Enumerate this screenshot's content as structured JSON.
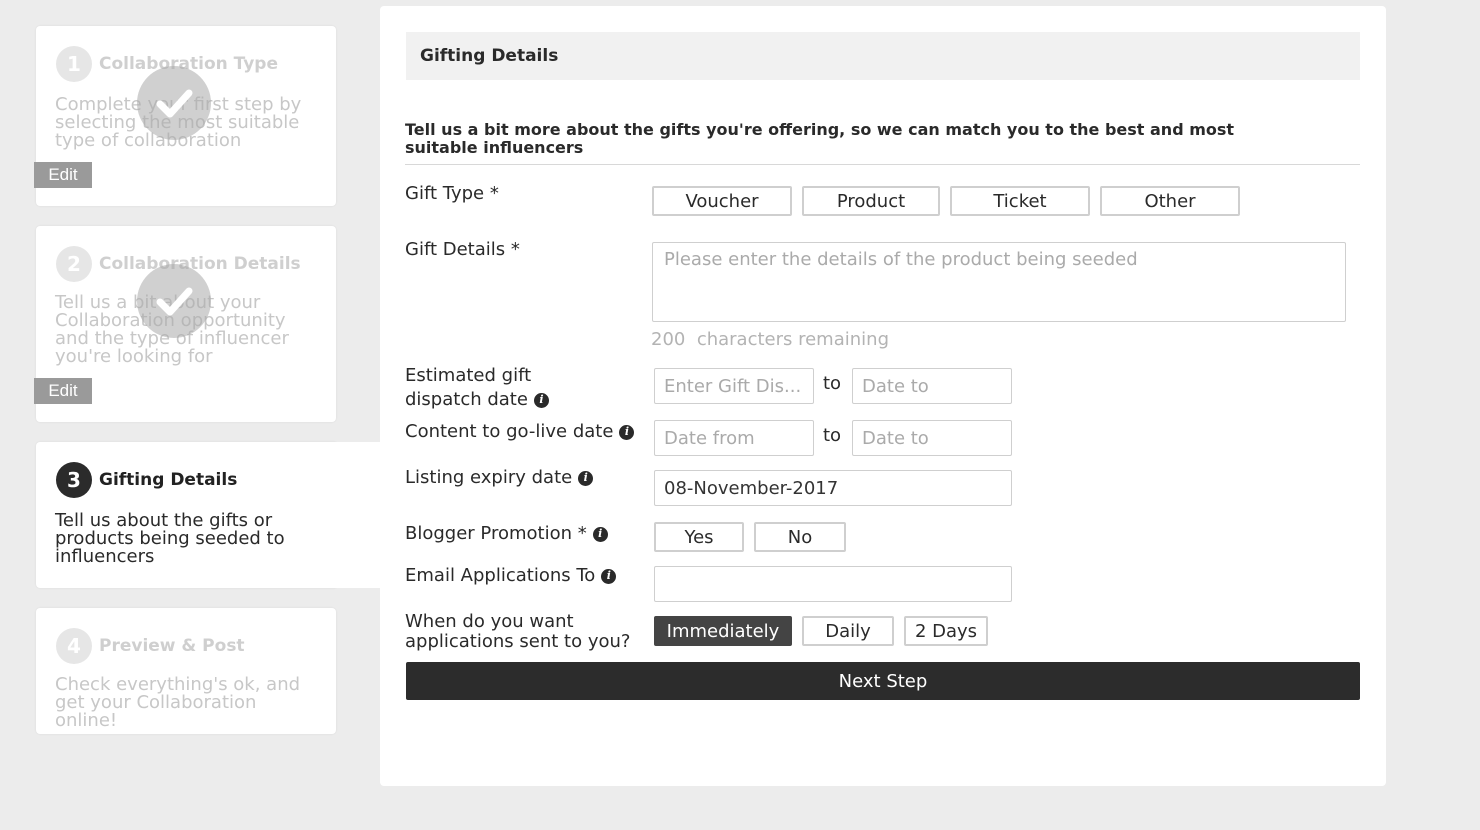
{
  "steps": [
    {
      "number": "1",
      "title": "Collaboration Type",
      "description": "Complete your first step by selecting the most suitable type of collaboration",
      "edit_label": "Edit",
      "status": "done"
    },
    {
      "number": "2",
      "title": "Collaboration Details",
      "description": "Tell us a bit about your Collaboration opportunity and the type of influencer you're looking for",
      "edit_label": "Edit",
      "status": "done"
    },
    {
      "number": "3",
      "title": "Gifting Details",
      "description": "Tell us about the gifts or products being seeded to influencers",
      "status": "active"
    },
    {
      "number": "4",
      "title": "Preview & Post",
      "description": "Check everything's ok, and get your Collaboration online!",
      "status": "pending"
    }
  ],
  "form": {
    "header": "Gifting Details",
    "intro": "Tell us a bit more about the gifts you're offering, so we can match you to the best and most suitable influencers",
    "gift_type": {
      "label": "Gift Type *",
      "options": [
        "Voucher",
        "Product",
        "Ticket",
        "Other"
      ]
    },
    "gift_details": {
      "label": "Gift Details *",
      "placeholder": "Please enter the details of the product being seeded",
      "chars_count": "200",
      "chars_text": "characters remaining"
    },
    "dispatch_date": {
      "label_line1": "Estimated gift",
      "label_line2": "dispatch date",
      "from_placeholder": "Enter Gift Dis...",
      "to_text": "to",
      "to_placeholder": "Date to"
    },
    "golive_date": {
      "label": "Content to go-live date",
      "from_placeholder": "Date from",
      "to_text": "to",
      "to_placeholder": "Date to"
    },
    "expiry_date": {
      "label": "Listing expiry date",
      "value": "08-November-2017"
    },
    "blogger_promotion": {
      "label": "Blogger Promotion *",
      "options": [
        "Yes",
        "No"
      ]
    },
    "email_applications": {
      "label": "Email Applications To",
      "value": ""
    },
    "frequency": {
      "label_line1": "When do you want",
      "label_line2": "applications sent to you?",
      "options": [
        "Immediately",
        "Daily",
        "2 Days"
      ],
      "selected": "Immediately"
    },
    "next_label": "Next Step"
  },
  "icons": {
    "info": "i",
    "check": "checkmark-icon"
  },
  "colors": {
    "accent_dark": "#2c2c2c",
    "selected_button": "#444444",
    "background": "#ececec"
  }
}
